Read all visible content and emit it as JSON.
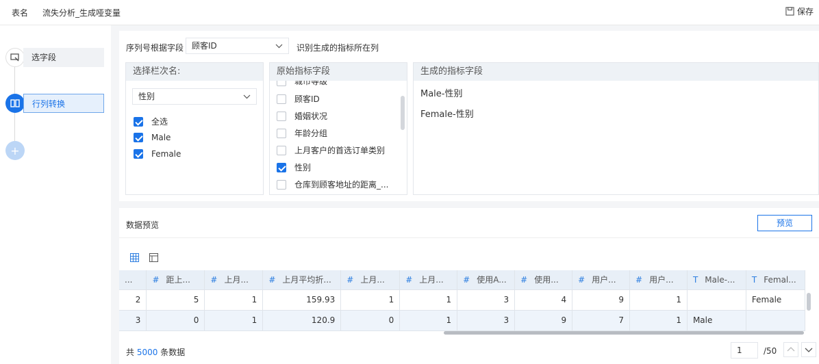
{
  "topbar": {
    "table_label": "表名",
    "table_name": "流失分析_生成哑变量",
    "save_label": "保存"
  },
  "sidebar": {
    "steps": [
      {
        "label": "选字段"
      },
      {
        "label": "行列转换"
      }
    ],
    "add_symbol": "+"
  },
  "config": {
    "seq_label": "序列号根据字段",
    "seq_value": "顾客ID",
    "seq_hint": "识别生成的指标所在列",
    "col1": {
      "header": "选择栏次名:",
      "select_value": "性别",
      "items": [
        {
          "label": "全选",
          "checked": true
        },
        {
          "label": "Male",
          "checked": true
        },
        {
          "label": "Female",
          "checked": true
        }
      ]
    },
    "col2": {
      "header": "原始指标字段",
      "items": [
        {
          "label": "城市等级",
          "checked": false
        },
        {
          "label": "顾客ID",
          "checked": false
        },
        {
          "label": "婚姻状况",
          "checked": false
        },
        {
          "label": "年龄分组",
          "checked": false
        },
        {
          "label": "上月客户的首选订单类别",
          "checked": false
        },
        {
          "label": "性别",
          "checked": true
        },
        {
          "label": "仓库到顾客地址的距离_...",
          "checked": false
        }
      ]
    },
    "col3": {
      "header": "生成的指标字段",
      "items": [
        "Male-性别",
        "Female-性别"
      ]
    }
  },
  "preview": {
    "title": "数据预览",
    "button": "预览",
    "columns": [
      {
        "type": "",
        "label": "..."
      },
      {
        "type": "#",
        "label": "距上..."
      },
      {
        "type": "#",
        "label": "上月..."
      },
      {
        "type": "#",
        "label": "上月平均折..."
      },
      {
        "type": "#",
        "label": "上月..."
      },
      {
        "type": "#",
        "label": "上月..."
      },
      {
        "type": "#",
        "label": "使用A..."
      },
      {
        "type": "#",
        "label": "使用..."
      },
      {
        "type": "#",
        "label": "用户..."
      },
      {
        "type": "#",
        "label": "用户..."
      },
      {
        "type": "T",
        "label": "Male-..."
      },
      {
        "type": "T",
        "label": "Femal..."
      }
    ],
    "rows": [
      [
        "2",
        "5",
        "1",
        "159.93",
        "1",
        "1",
        "3",
        "4",
        "9",
        "1",
        "",
        "Female"
      ],
      [
        "3",
        "0",
        "1",
        "120.9",
        "0",
        "1",
        "3",
        "9",
        "7",
        "1",
        "Male",
        ""
      ]
    ],
    "total_prefix": "共",
    "total_count": "5000",
    "total_suffix": "条数据",
    "page_current": "1",
    "page_total": "/50"
  },
  "colors": {
    "accent": "#1a73e8",
    "header_bg": "#eef2f6"
  }
}
